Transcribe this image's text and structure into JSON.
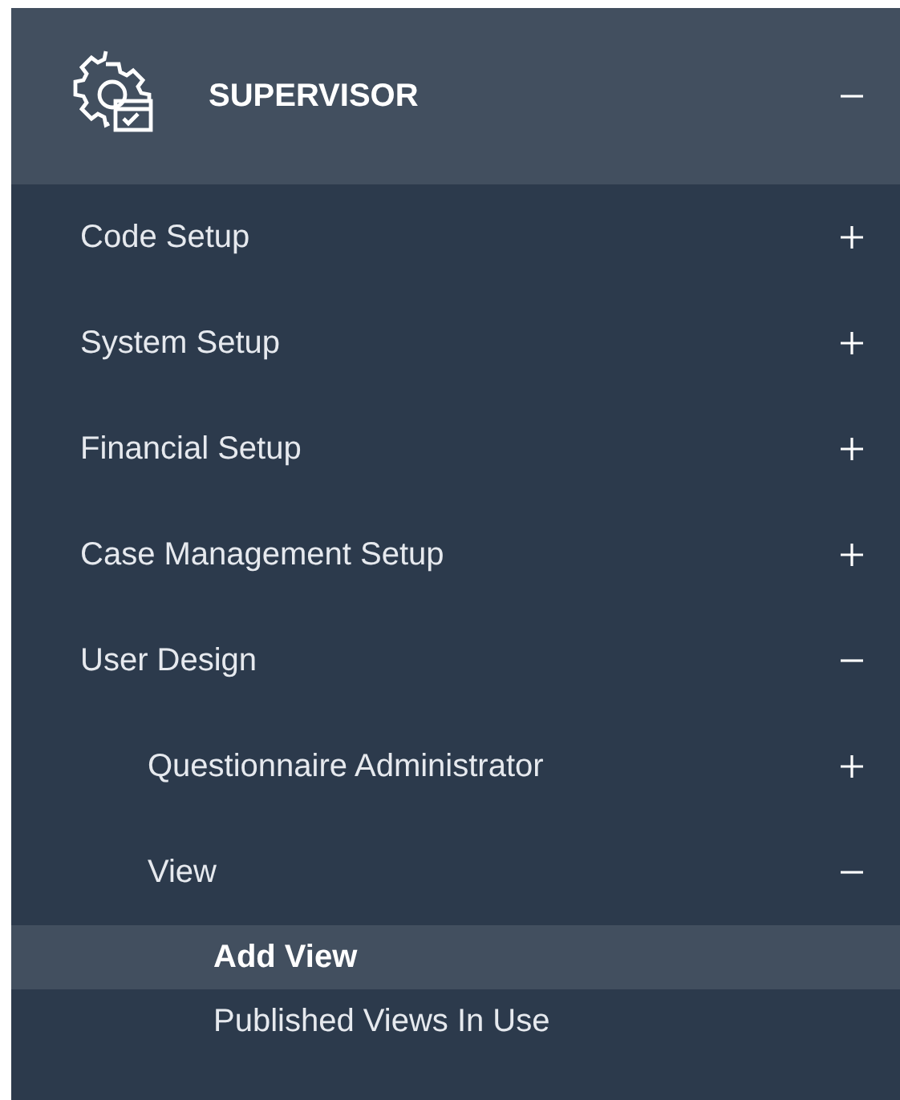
{
  "header": {
    "title": "SUPERVISOR",
    "expanded": true
  },
  "items": [
    {
      "label": "Code Setup",
      "expanded": false
    },
    {
      "label": "System Setup",
      "expanded": false
    },
    {
      "label": "Financial Setup",
      "expanded": false
    },
    {
      "label": "Case Management Setup",
      "expanded": false
    },
    {
      "label": "User Design",
      "expanded": true,
      "children": [
        {
          "label": "Questionnaire Administrator",
          "expanded": false
        },
        {
          "label": "View",
          "expanded": true,
          "children": [
            {
              "label": "Add View",
              "selected": true
            },
            {
              "label": "Published Views In Use",
              "selected": false
            }
          ]
        }
      ]
    }
  ]
}
